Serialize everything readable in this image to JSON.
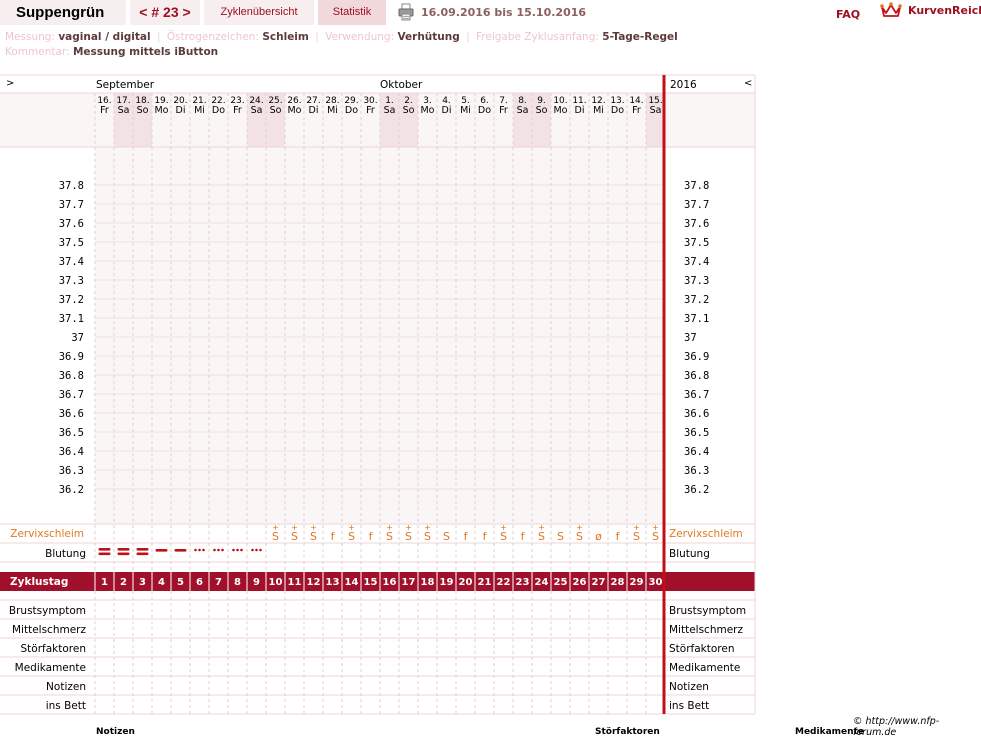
{
  "header": {
    "app_title": "Suppengrün",
    "cycle_nav": "< # 23 >",
    "tab_overview": "Zyklenübersicht",
    "tab_stats": "Statistik",
    "date_range": "16.09.2016 bis 15.10.2016",
    "faq": "FAQ",
    "logo_text": "KurvenReich"
  },
  "meta": {
    "measurement_label": "Messung:",
    "measurement_value": "vaginal / digital",
    "estrogen_label": "Östrogenzeichen:",
    "estrogen_value": "Schleim",
    "usage_label": "Verwendung:",
    "usage_value": "Verhütung",
    "release_label": "Freigabe Zyklusanfang:",
    "release_value": "5-Tage-Regel",
    "comment_label": "Kommentar:",
    "comment_value": "Messung mittels iButton"
  },
  "nav": {
    "prev": ">",
    "next": "<",
    "year": "2016",
    "month_sep": "September",
    "month_oct": "Oktober"
  },
  "days": [
    {
      "date": "16.",
      "dow": "Fr",
      "weekend": false
    },
    {
      "date": "17.",
      "dow": "Sa",
      "weekend": true
    },
    {
      "date": "18.",
      "dow": "So",
      "weekend": true
    },
    {
      "date": "19.",
      "dow": "Mo",
      "weekend": false
    },
    {
      "date": "20.",
      "dow": "Di",
      "weekend": false
    },
    {
      "date": "21.",
      "dow": "Mi",
      "weekend": false
    },
    {
      "date": "22.",
      "dow": "Do",
      "weekend": false
    },
    {
      "date": "23.",
      "dow": "Fr",
      "weekend": false
    },
    {
      "date": "24.",
      "dow": "Sa",
      "weekend": true
    },
    {
      "date": "25.",
      "dow": "So",
      "weekend": true
    },
    {
      "date": "26.",
      "dow": "Mo",
      "weekend": false
    },
    {
      "date": "27.",
      "dow": "Di",
      "weekend": false
    },
    {
      "date": "28.",
      "dow": "Mi",
      "weekend": false
    },
    {
      "date": "29.",
      "dow": "Do",
      "weekend": false
    },
    {
      "date": "30.",
      "dow": "Fr",
      "weekend": false
    },
    {
      "date": "1.",
      "dow": "Sa",
      "weekend": true
    },
    {
      "date": "2.",
      "dow": "So",
      "weekend": true
    },
    {
      "date": "3.",
      "dow": "Mo",
      "weekend": false
    },
    {
      "date": "4.",
      "dow": "Di",
      "weekend": false
    },
    {
      "date": "5.",
      "dow": "Mi",
      "weekend": false
    },
    {
      "date": "6.",
      "dow": "Do",
      "weekend": false
    },
    {
      "date": "7.",
      "dow": "Fr",
      "weekend": false
    },
    {
      "date": "8.",
      "dow": "Sa",
      "weekend": true
    },
    {
      "date": "9.",
      "dow": "So",
      "weekend": true
    },
    {
      "date": "10.",
      "dow": "Mo",
      "weekend": false
    },
    {
      "date": "11.",
      "dow": "Di",
      "weekend": false
    },
    {
      "date": "12.",
      "dow": "Mi",
      "weekend": false
    },
    {
      "date": "13.",
      "dow": "Do",
      "weekend": false
    },
    {
      "date": "14.",
      "dow": "Fr",
      "weekend": false
    },
    {
      "date": "15.",
      "dow": "Sa",
      "weekend": true
    }
  ],
  "temperature_labels": [
    "37.8",
    "37.7",
    "37.6",
    "37.5",
    "37.4",
    "37.3",
    "37.2",
    "37.1",
    "37",
    "36.9",
    "36.8",
    "36.7",
    "36.6",
    "36.5",
    "36.4",
    "36.3",
    "36.2"
  ],
  "rows": {
    "cervix": "Zervixschleim",
    "bleeding": "Blutung",
    "cycle_day": "Zyklustag",
    "breast": "Brustsymptom",
    "midpain": "Mittelschmerz",
    "disturb": "Störfaktoren",
    "meds": "Medikamente",
    "notes": "Notizen",
    "bed": "ins Bett"
  },
  "cervix_values": [
    "",
    "",
    "",
    "",
    "",
    "",
    "",
    "",
    "",
    "S+",
    "S+",
    "S+",
    "f",
    "S+",
    "f",
    "S+",
    "S+",
    "S+",
    "S",
    "f",
    "f",
    "S+",
    "f",
    "S+",
    "S",
    "S+",
    "ø",
    "f",
    "S+",
    "S+"
  ],
  "bleeding_values": [
    "heavy",
    "heavy",
    "heavy",
    "medium",
    "medium",
    "light",
    "light",
    "light",
    "light",
    "",
    "",
    "",
    "",
    "",
    "",
    "",
    "",
    "",
    "",
    "",
    "",
    "",
    "",
    "",
    "",
    "",
    "",
    "",
    "",
    ""
  ],
  "cycle_days": [
    "1",
    "2",
    "3",
    "4",
    "5",
    "6",
    "7",
    "8",
    "9",
    "10",
    "11",
    "12",
    "13",
    "14",
    "15",
    "16",
    "17",
    "18",
    "19",
    "20",
    "21",
    "22",
    "23",
    "24",
    "25",
    "26",
    "27",
    "28",
    "29",
    "30"
  ],
  "footer": {
    "copyright": "© http://www.nfp-forum.de",
    "col_notes": "Notizen",
    "col_disturb": "Störfaktoren",
    "col_meds": "Medikamente"
  },
  "colors": {
    "brand": "#9e1020",
    "cycle_row": "#a0102a",
    "grid_bg": "#fbf6f6",
    "weekend_bg": "#f2e2e4",
    "cervix_text": "#e07820",
    "line_pink": "#ecd4d6",
    "divider_red": "#c01018"
  },
  "icons": {
    "print": "printer-icon",
    "logo": "crown-logo-icon"
  }
}
